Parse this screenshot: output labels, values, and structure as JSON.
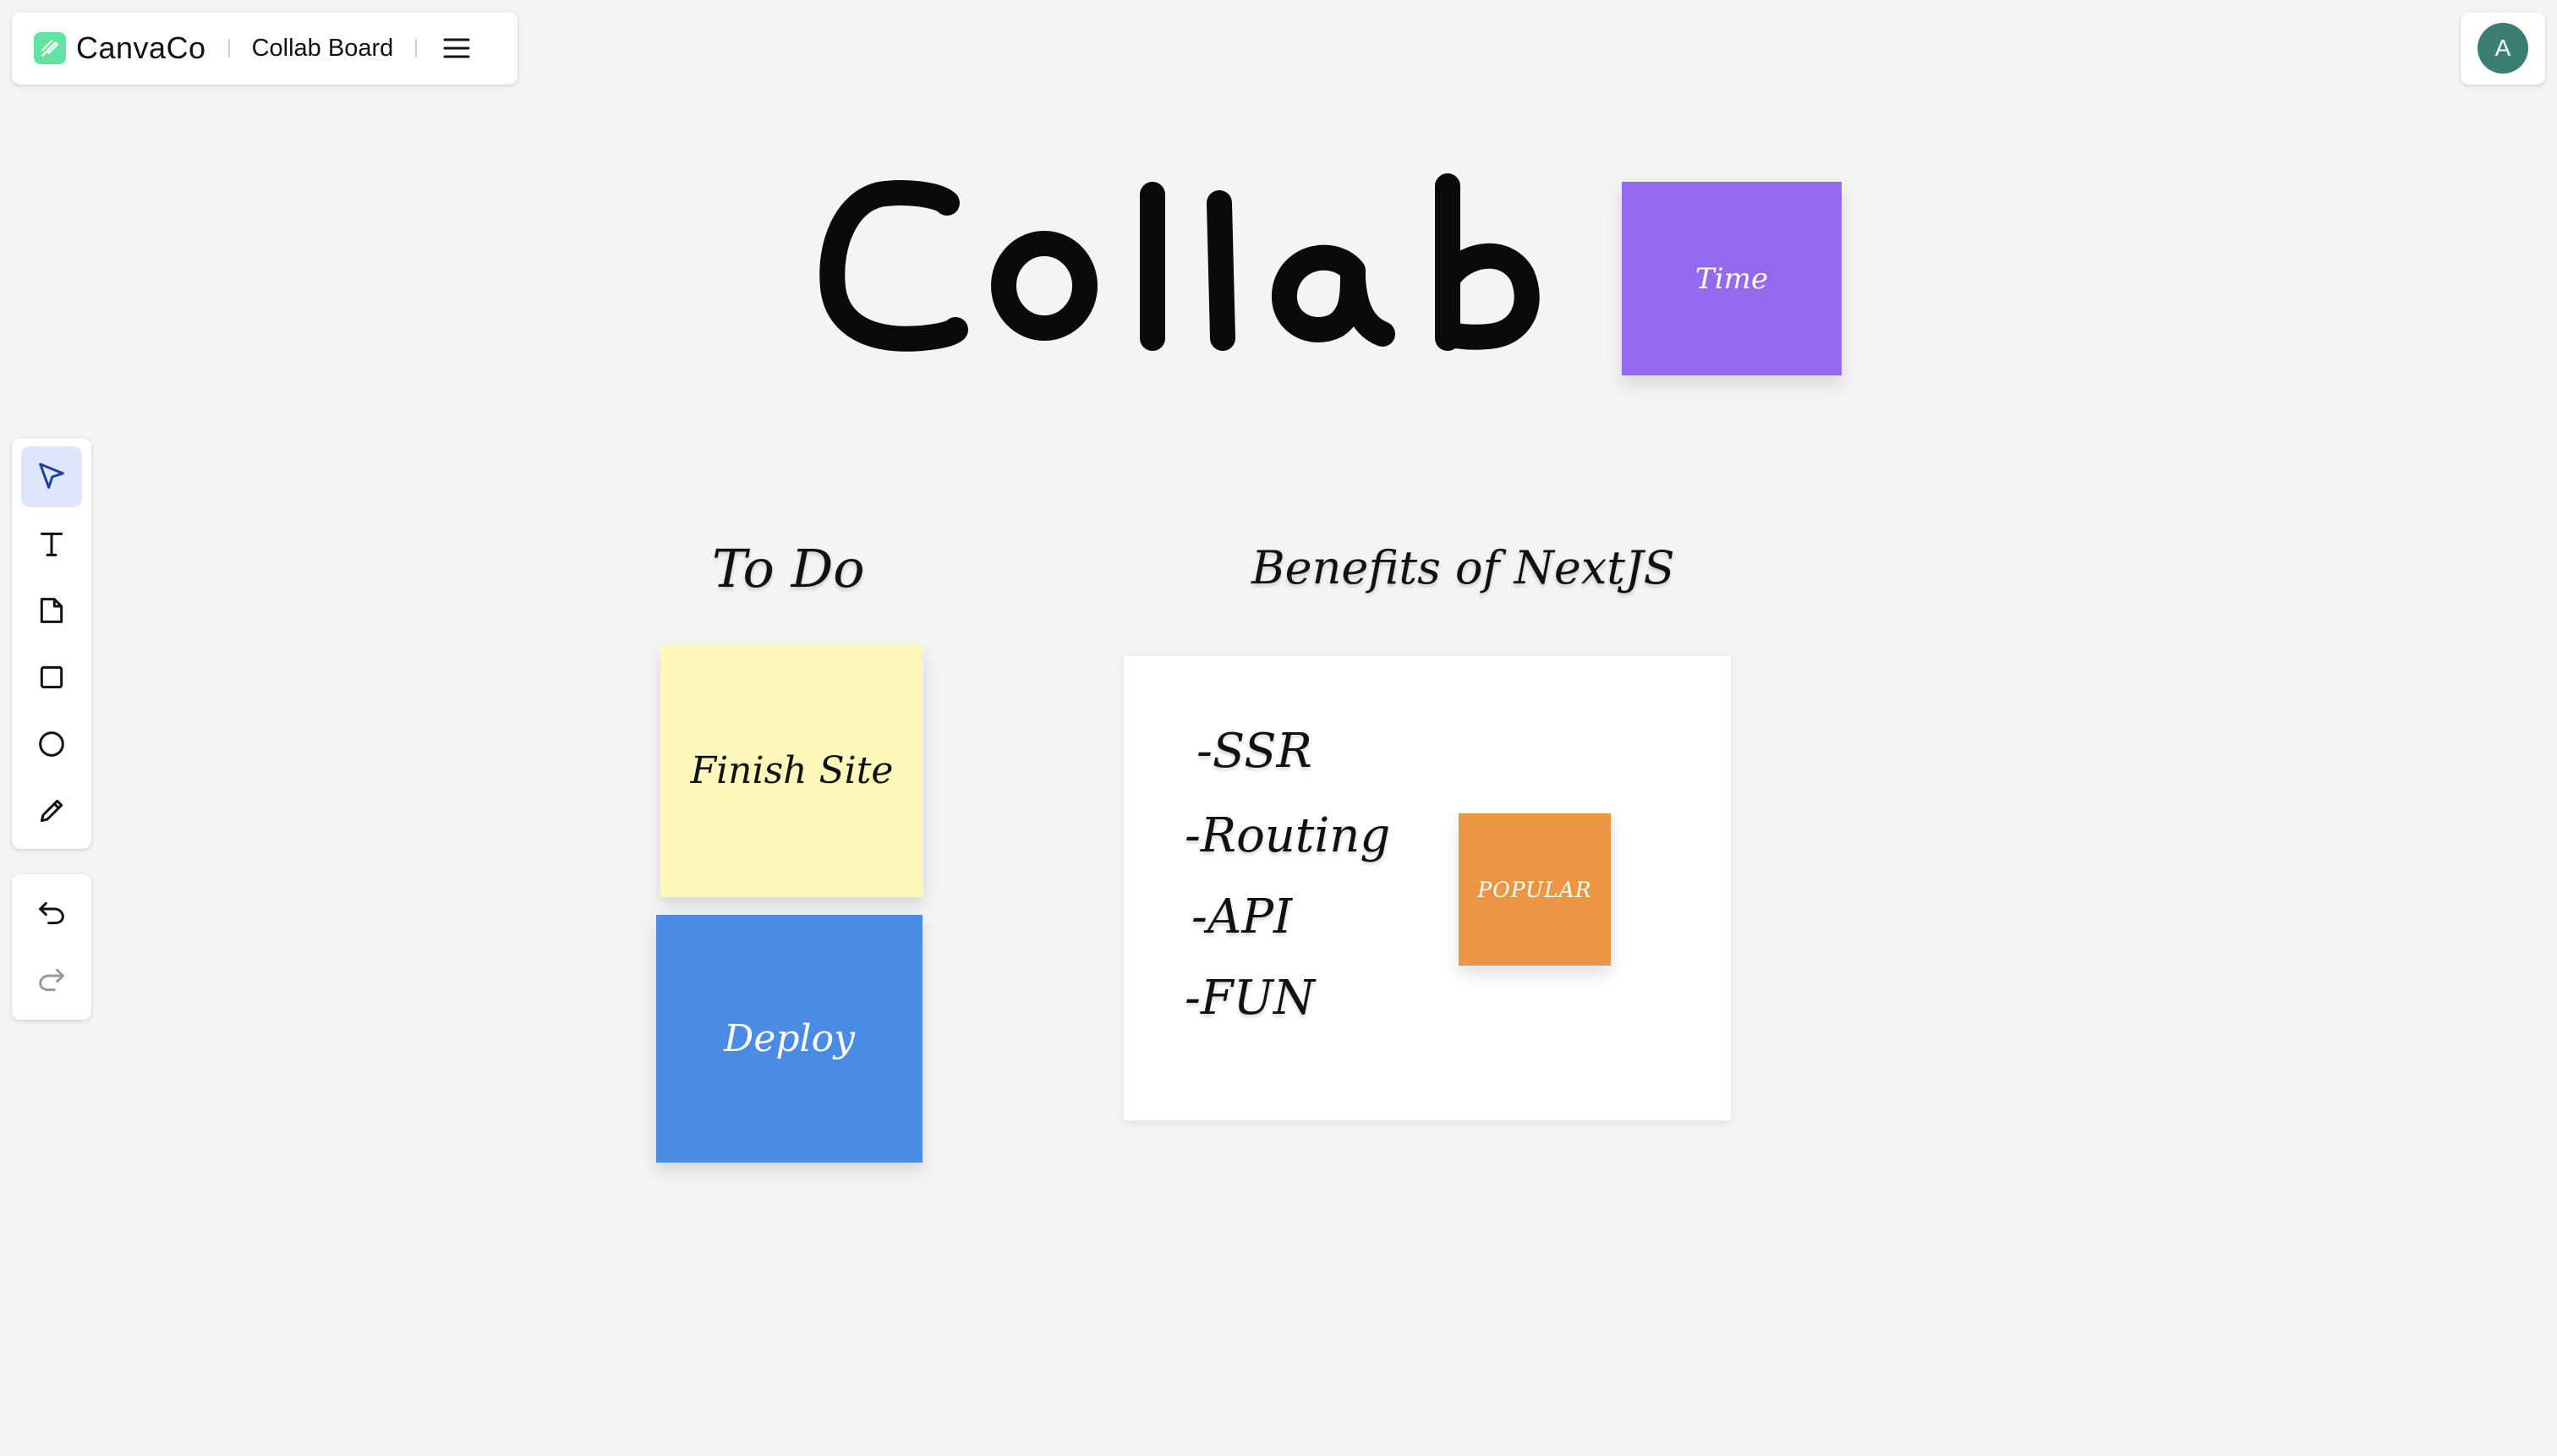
{
  "header": {
    "app_name": "CanvaCo",
    "board_title": "Collab Board",
    "logo_icon": "pen-logo-icon",
    "menu_icon": "hamburger-menu-icon"
  },
  "user": {
    "avatar_initial": "A",
    "avatar_color": "#3b7e74"
  },
  "toolbar": {
    "tools": [
      {
        "name": "select",
        "icon": "cursor-arrow-icon",
        "active": true
      },
      {
        "name": "text",
        "icon": "text-icon",
        "active": false
      },
      {
        "name": "sticky-note",
        "icon": "sticky-note-icon",
        "active": false
      },
      {
        "name": "rectangle",
        "icon": "square-icon",
        "active": false
      },
      {
        "name": "ellipse",
        "icon": "circle-icon",
        "active": false
      },
      {
        "name": "pen",
        "icon": "pencil-icon",
        "active": false
      }
    ],
    "history": [
      {
        "name": "undo",
        "icon": "undo-icon",
        "enabled": true
      },
      {
        "name": "redo",
        "icon": "redo-icon",
        "enabled": false
      }
    ]
  },
  "canvas": {
    "drawing_text": "Collab",
    "stickies": {
      "time": {
        "text": "Time",
        "color": "#9369ed"
      },
      "finish_site": {
        "text": "Finish Site",
        "color": "#fdf8b9"
      },
      "deploy": {
        "text": "Deploy",
        "color": "#4a8ce5"
      },
      "popular": {
        "text": "POPULAR",
        "color": "#ec9542"
      }
    },
    "todo_heading": "To Do",
    "benefits_heading": "Benefits of NextJS",
    "benefits": [
      "-SSR",
      "-Routing",
      "-API",
      "-FUN"
    ]
  }
}
